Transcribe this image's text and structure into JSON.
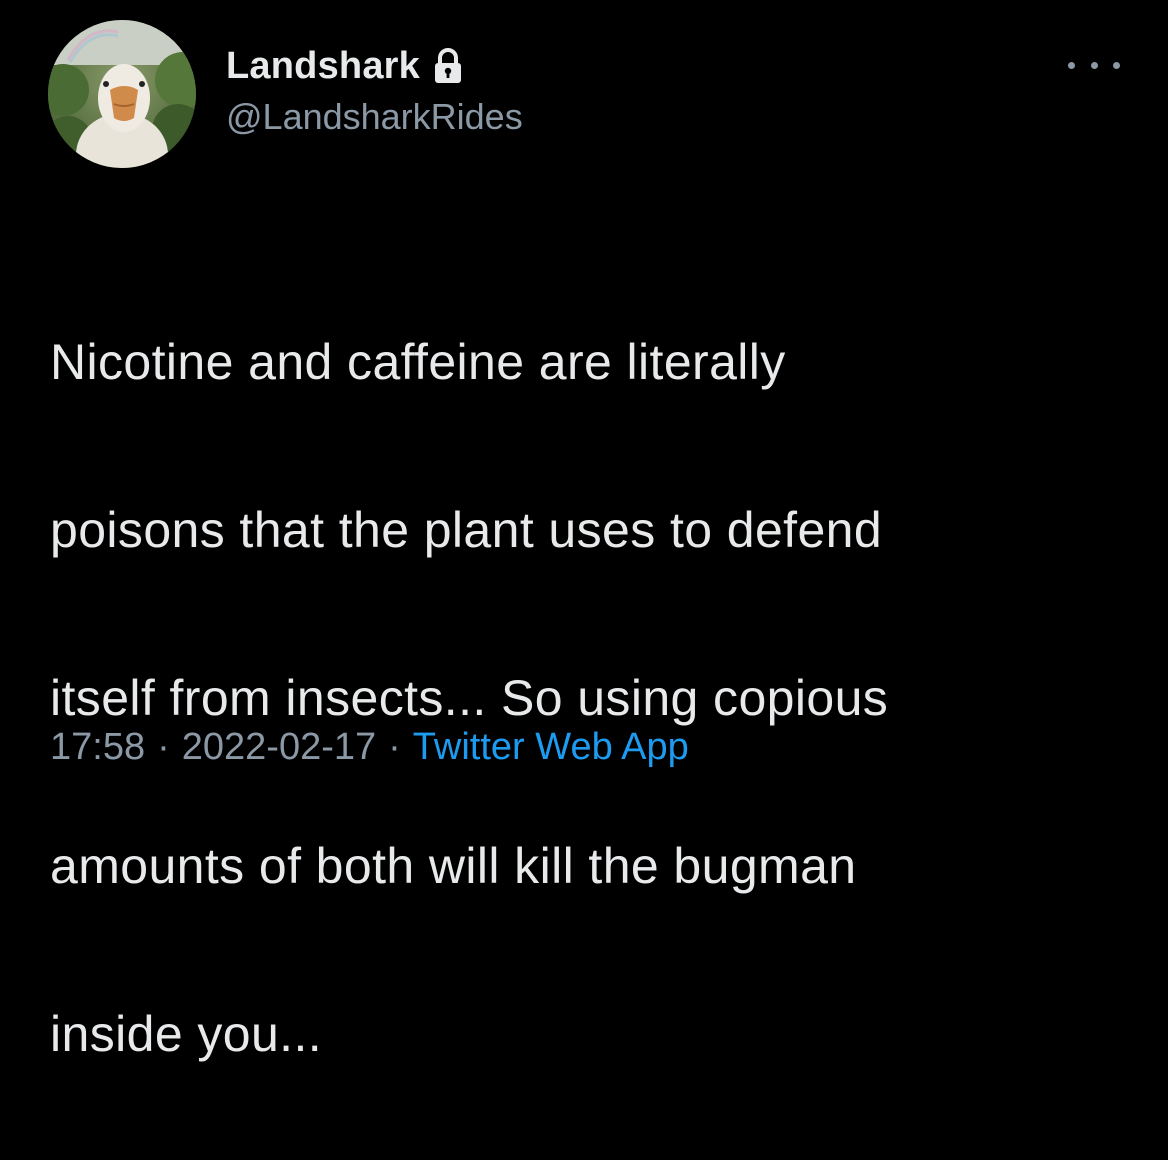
{
  "tweet": {
    "author": {
      "display_name": "Landshark",
      "handle": "@LandsharkRides",
      "protected_icon": "lock-icon",
      "avatar_icon": "duck-avatar"
    },
    "more_icon": "more-horizontal-icon",
    "text_lines": [
      "Nicotine and caffeine are literally",
      "poisons that the plant uses to defend",
      "itself from insects... So using copious",
      "amounts of both will kill the bugman",
      "inside you..."
    ],
    "meta": {
      "time": "17:58",
      "separator": "·",
      "date": "2022-02-17",
      "source": "Twitter Web App"
    }
  },
  "colors": {
    "background": "#000000",
    "primary_text": "#e7e9ea",
    "secondary_text": "#8b98a5",
    "link": "#1d9bf0"
  }
}
